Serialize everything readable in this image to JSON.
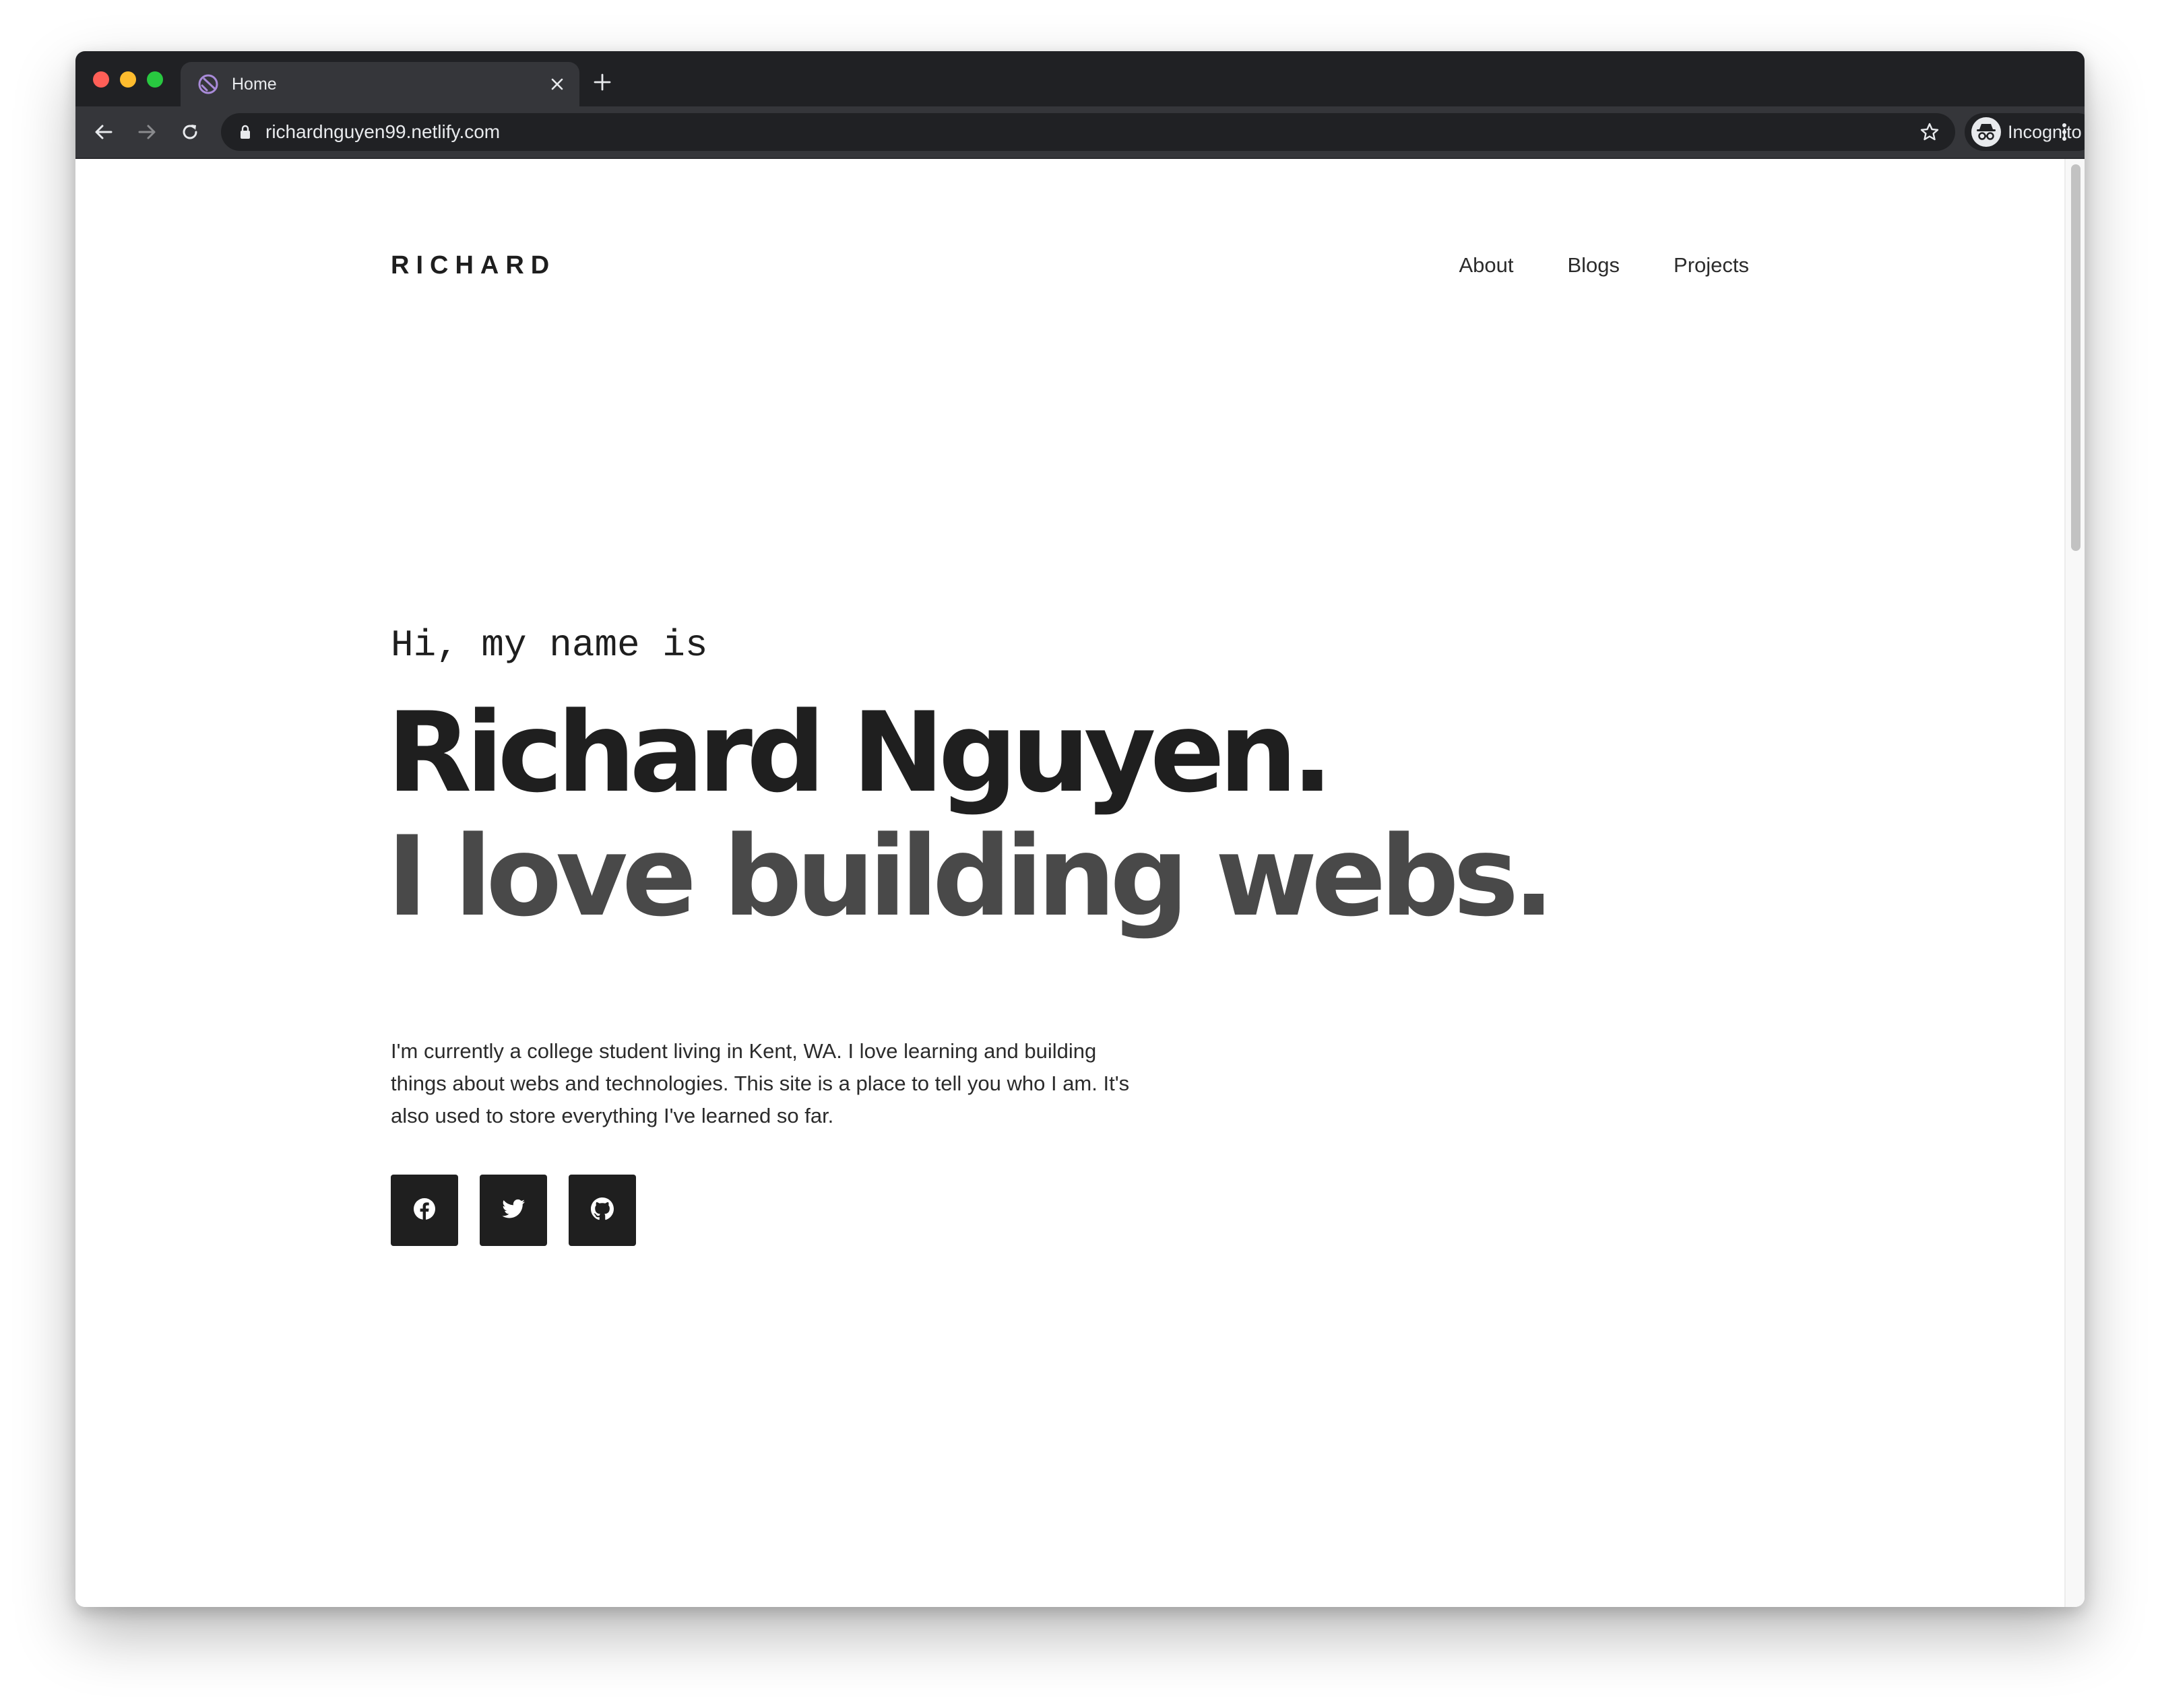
{
  "browser": {
    "tab": {
      "title": "Home",
      "favicon_icon": "gatsby-icon",
      "close_icon": "close-icon"
    },
    "new_tab_icon": "plus-icon",
    "nav": {
      "back_icon": "arrow-left-icon",
      "forward_icon": "arrow-right-icon",
      "reload_icon": "reload-icon"
    },
    "address_bar": {
      "url": "richardnguyen99.netlify.com",
      "lock_icon": "lock-icon",
      "bookmark_icon": "star-icon"
    },
    "profile": {
      "label": "Incognito",
      "icon": "incognito-icon"
    },
    "menu_icon": "kebab-menu-icon"
  },
  "site": {
    "brand": "RICHARD",
    "nav": [
      {
        "label": "About"
      },
      {
        "label": "Blogs"
      },
      {
        "label": "Projects"
      }
    ],
    "hero": {
      "greeting": "Hi, my name is",
      "name": "Richard Nguyen.",
      "tagline": "I love building webs."
    },
    "bio": "I'm currently a college student living in Kent, WA. I love learning and building things about webs and technologies. This site is a place to tell you who I am. It's also used to store everything I've learned so far.",
    "socials": [
      {
        "icon": "facebook-icon"
      },
      {
        "icon": "twitter-icon"
      },
      {
        "icon": "github-icon"
      }
    ]
  },
  "colors": {
    "chrome_dark": "#202124",
    "chrome_toolbar": "#35363a",
    "text_primary": "#1f1f1f",
    "text_secondary": "#494949",
    "button_bg": "#1f1f1f"
  }
}
